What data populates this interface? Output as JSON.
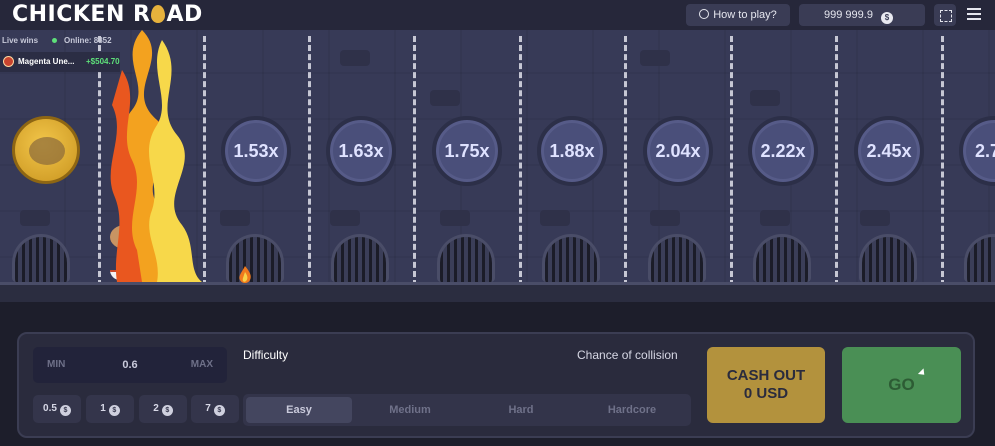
{
  "header": {
    "logo_text_a": "CHICKEN R",
    "logo_text_b": "AD",
    "how_to_play": "How to play?",
    "balance": "999 999.9",
    "currency_symbol": "$"
  },
  "live": {
    "title": "Live wins",
    "online": "Online: 8852",
    "user": "Magenta Une...",
    "amount": "+$504.70"
  },
  "multipliers": [
    "1.53x",
    "1.63x",
    "1.75x",
    "1.88x",
    "2.04x",
    "2.22x",
    "2.45x",
    "2.7"
  ],
  "controls": {
    "min_label": "MIN",
    "max_label": "MAX",
    "bet_value": "0.6",
    "quick_bets": [
      "0.5",
      "1",
      "2",
      "7"
    ],
    "difficulty_label": "Difficulty",
    "chance_label": "Chance of collision",
    "difficulties": [
      "Easy",
      "Medium",
      "Hard",
      "Hardcore"
    ],
    "active_difficulty": "Easy",
    "cashout_line1": "CASH OUT",
    "cashout_line2": "0 USD",
    "go_label": "GO"
  },
  "colors": {
    "cashout": "#b3923d",
    "go": "#4a8f55",
    "win_amount": "#5ee07a"
  }
}
